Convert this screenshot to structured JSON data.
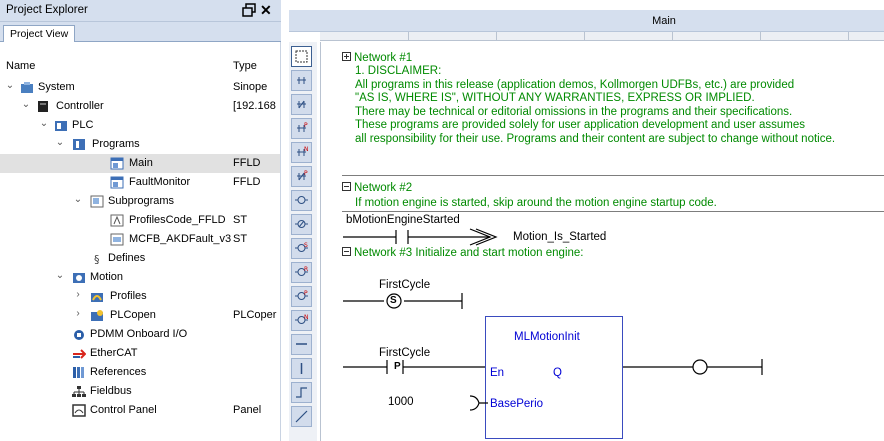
{
  "explorer": {
    "title": "Project Explorer",
    "tab": "Project View",
    "columns": {
      "name": "Name",
      "type": "Type"
    },
    "rows": [
      {
        "label": "System",
        "type": "Sinope"
      },
      {
        "label": "Controller",
        "type": "[192.168"
      },
      {
        "label": "PLC",
        "type": ""
      },
      {
        "label": "Programs",
        "type": ""
      },
      {
        "label": "Main",
        "type": "FFLD"
      },
      {
        "label": "FaultMonitor",
        "type": "FFLD"
      },
      {
        "label": "Subprograms",
        "type": ""
      },
      {
        "label": "ProfilesCode_FFLD",
        "type": "ST"
      },
      {
        "label": "MCFB_AKDFault_v3",
        "type": "ST"
      },
      {
        "label": "Defines",
        "type": ""
      },
      {
        "label": "Motion",
        "type": ""
      },
      {
        "label": "Profiles",
        "type": ""
      },
      {
        "label": "PLCopen",
        "type": "PLCoper"
      },
      {
        "label": "PDMM Onboard I/O",
        "type": ""
      },
      {
        "label": "EtherCAT",
        "type": ""
      },
      {
        "label": "References",
        "type": ""
      },
      {
        "label": "Fieldbus",
        "type": ""
      },
      {
        "label": "Control Panel",
        "type": "Panel"
      }
    ]
  },
  "editor": {
    "title": "Main",
    "network1": {
      "header": "Network #1",
      "lines": [
        "1. DISCLAIMER:",
        "All programs in this release (application demos, Kollmorgen UDFBs, etc.) are provided",
        "\"AS IS, WHERE IS\", WITHOUT ANY WARRANTIES, EXPRESS OR IMPLIED.",
        "There may be technical or editorial omissions in the programs and their specifications.",
        "These programs are provided solely for user application development and user assumes",
        "all responsibility for their use. Programs and their content are subject to change without notice."
      ]
    },
    "network2": {
      "header": "Network #2",
      "comment": "If motion engine is started, skip around the motion engine startup code.",
      "contact_var": "bMotionEngineStarted",
      "jump_label": "Motion_Is_Started"
    },
    "network3": {
      "header": "Network #3 Initialize and start motion engine:",
      "firstcycle1": "FirstCycle",
      "set_coil_symbol": "S",
      "firstcycle2": "FirstCycle",
      "p_contact_symbol": "P",
      "const_value": "1000",
      "block": {
        "name": "MLMotionInit",
        "in_en": "En",
        "out_q": "Q",
        "in_base": "BasePerio"
      }
    }
  },
  "colors": {
    "panel_header": "#d5dfee",
    "comment_green": "#008a00",
    "block_blue": "#0000d5"
  }
}
